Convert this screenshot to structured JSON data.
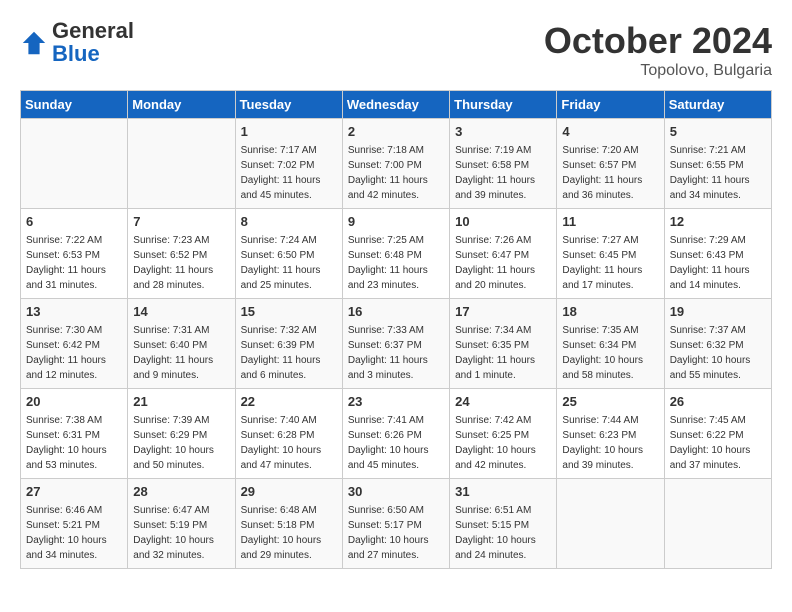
{
  "header": {
    "logo_general": "General",
    "logo_blue": "Blue",
    "month": "October 2024",
    "location": "Topolovo, Bulgaria"
  },
  "days_of_week": [
    "Sunday",
    "Monday",
    "Tuesday",
    "Wednesday",
    "Thursday",
    "Friday",
    "Saturday"
  ],
  "weeks": [
    [
      {
        "day": "",
        "info": ""
      },
      {
        "day": "",
        "info": ""
      },
      {
        "day": "1",
        "info": "Sunrise: 7:17 AM\nSunset: 7:02 PM\nDaylight: 11 hours and 45 minutes."
      },
      {
        "day": "2",
        "info": "Sunrise: 7:18 AM\nSunset: 7:00 PM\nDaylight: 11 hours and 42 minutes."
      },
      {
        "day": "3",
        "info": "Sunrise: 7:19 AM\nSunset: 6:58 PM\nDaylight: 11 hours and 39 minutes."
      },
      {
        "day": "4",
        "info": "Sunrise: 7:20 AM\nSunset: 6:57 PM\nDaylight: 11 hours and 36 minutes."
      },
      {
        "day": "5",
        "info": "Sunrise: 7:21 AM\nSunset: 6:55 PM\nDaylight: 11 hours and 34 minutes."
      }
    ],
    [
      {
        "day": "6",
        "info": "Sunrise: 7:22 AM\nSunset: 6:53 PM\nDaylight: 11 hours and 31 minutes."
      },
      {
        "day": "7",
        "info": "Sunrise: 7:23 AM\nSunset: 6:52 PM\nDaylight: 11 hours and 28 minutes."
      },
      {
        "day": "8",
        "info": "Sunrise: 7:24 AM\nSunset: 6:50 PM\nDaylight: 11 hours and 25 minutes."
      },
      {
        "day": "9",
        "info": "Sunrise: 7:25 AM\nSunset: 6:48 PM\nDaylight: 11 hours and 23 minutes."
      },
      {
        "day": "10",
        "info": "Sunrise: 7:26 AM\nSunset: 6:47 PM\nDaylight: 11 hours and 20 minutes."
      },
      {
        "day": "11",
        "info": "Sunrise: 7:27 AM\nSunset: 6:45 PM\nDaylight: 11 hours and 17 minutes."
      },
      {
        "day": "12",
        "info": "Sunrise: 7:29 AM\nSunset: 6:43 PM\nDaylight: 11 hours and 14 minutes."
      }
    ],
    [
      {
        "day": "13",
        "info": "Sunrise: 7:30 AM\nSunset: 6:42 PM\nDaylight: 11 hours and 12 minutes."
      },
      {
        "day": "14",
        "info": "Sunrise: 7:31 AM\nSunset: 6:40 PM\nDaylight: 11 hours and 9 minutes."
      },
      {
        "day": "15",
        "info": "Sunrise: 7:32 AM\nSunset: 6:39 PM\nDaylight: 11 hours and 6 minutes."
      },
      {
        "day": "16",
        "info": "Sunrise: 7:33 AM\nSunset: 6:37 PM\nDaylight: 11 hours and 3 minutes."
      },
      {
        "day": "17",
        "info": "Sunrise: 7:34 AM\nSunset: 6:35 PM\nDaylight: 11 hours and 1 minute."
      },
      {
        "day": "18",
        "info": "Sunrise: 7:35 AM\nSunset: 6:34 PM\nDaylight: 10 hours and 58 minutes."
      },
      {
        "day": "19",
        "info": "Sunrise: 7:37 AM\nSunset: 6:32 PM\nDaylight: 10 hours and 55 minutes."
      }
    ],
    [
      {
        "day": "20",
        "info": "Sunrise: 7:38 AM\nSunset: 6:31 PM\nDaylight: 10 hours and 53 minutes."
      },
      {
        "day": "21",
        "info": "Sunrise: 7:39 AM\nSunset: 6:29 PM\nDaylight: 10 hours and 50 minutes."
      },
      {
        "day": "22",
        "info": "Sunrise: 7:40 AM\nSunset: 6:28 PM\nDaylight: 10 hours and 47 minutes."
      },
      {
        "day": "23",
        "info": "Sunrise: 7:41 AM\nSunset: 6:26 PM\nDaylight: 10 hours and 45 minutes."
      },
      {
        "day": "24",
        "info": "Sunrise: 7:42 AM\nSunset: 6:25 PM\nDaylight: 10 hours and 42 minutes."
      },
      {
        "day": "25",
        "info": "Sunrise: 7:44 AM\nSunset: 6:23 PM\nDaylight: 10 hours and 39 minutes."
      },
      {
        "day": "26",
        "info": "Sunrise: 7:45 AM\nSunset: 6:22 PM\nDaylight: 10 hours and 37 minutes."
      }
    ],
    [
      {
        "day": "27",
        "info": "Sunrise: 6:46 AM\nSunset: 5:21 PM\nDaylight: 10 hours and 34 minutes."
      },
      {
        "day": "28",
        "info": "Sunrise: 6:47 AM\nSunset: 5:19 PM\nDaylight: 10 hours and 32 minutes."
      },
      {
        "day": "29",
        "info": "Sunrise: 6:48 AM\nSunset: 5:18 PM\nDaylight: 10 hours and 29 minutes."
      },
      {
        "day": "30",
        "info": "Sunrise: 6:50 AM\nSunset: 5:17 PM\nDaylight: 10 hours and 27 minutes."
      },
      {
        "day": "31",
        "info": "Sunrise: 6:51 AM\nSunset: 5:15 PM\nDaylight: 10 hours and 24 minutes."
      },
      {
        "day": "",
        "info": ""
      },
      {
        "day": "",
        "info": ""
      }
    ]
  ]
}
